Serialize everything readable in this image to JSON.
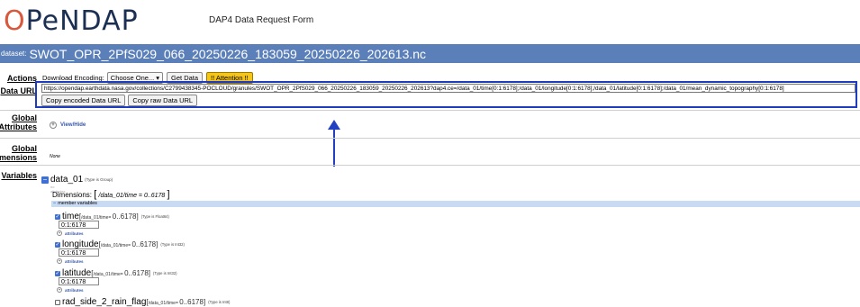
{
  "header": {
    "logo_text": "OPeNDAP",
    "form_title": "DAP4 Data Request Form"
  },
  "dataset": {
    "prefix": "dataset:",
    "name": "SWOT_OPR_2PfS029_066_20250226_183059_20250226_202613.nc"
  },
  "labels": {
    "actions": "Actions",
    "data_url": "Data URL",
    "global_attributes": "Global Attributes",
    "global_dimensions": "Global Dimensions",
    "variables": "Variables"
  },
  "actions": {
    "download_encoding_label": "Download Encoding:",
    "encoding_selected": "Choose One...",
    "get_data": "Get Data",
    "attention": "!! Attention !!"
  },
  "data_url": {
    "value": "https://opendap.earthdata.nasa.gov/collections/C2799438345-POCLOUD/granules/SWOT_OPR_2PfS029_066_20250226_183059_20250226_202613?dap4.ce=/data_01/time[0:1:6178];/data_01/longitude[0:1:6178];/data_01/latitude[0:1:6178];/data_01/mean_dynamic_topography[0:1:6178]",
    "copy_encoded": "Copy encoded Data URL",
    "copy_raw": "Copy raw Data URL"
  },
  "global_attributes": {
    "toggle_label": "View/Hide"
  },
  "global_dimensions": {
    "value": "None"
  },
  "variables": {
    "group": {
      "name": "data_01",
      "type_note": "(Type is Group)",
      "no_attributes": "no attributes",
      "dims_label": "Dimensions:",
      "dims_open": "[",
      "dims_value": "/data_01/time = 0..6178",
      "dims_close": "]",
      "member_label": "member variables"
    },
    "items": [
      {
        "name": "time",
        "dim_open": "[",
        "dim_path": "/data_01/time=",
        "dim_range": "0..6178",
        "dim_close": "]",
        "type": "(Type is Float64)",
        "constraint": "0:1:6178",
        "attributes_label": "attributes",
        "checked": true
      },
      {
        "name": "longitude",
        "dim_open": "[",
        "dim_path": "/data_01/time=",
        "dim_range": "0..6178",
        "dim_close": "]",
        "type": "(Type is Int32)",
        "constraint": "0:1:6178",
        "attributes_label": "attributes",
        "checked": true
      },
      {
        "name": "latitude",
        "dim_open": "[",
        "dim_path": "/data_01/time=",
        "dim_range": "0..6178",
        "dim_close": "]",
        "type": "(Type is Int32)",
        "constraint": "0:1:6178",
        "attributes_label": "attributes",
        "checked": true
      },
      {
        "name": "rad_side_2_rain_flag",
        "dim_open": "[",
        "dim_path": "/data_01/time=",
        "dim_range": "0..6178",
        "dim_close": "]",
        "type": "(Type is Int8)",
        "checked": false
      }
    ]
  },
  "colors": {
    "dataset_bar": "#5b7fb8",
    "highlight": "#1f3cbe",
    "attention": "#f5c518",
    "checkbox": "#3f6fd1",
    "member_bar": "#c9daf3"
  }
}
